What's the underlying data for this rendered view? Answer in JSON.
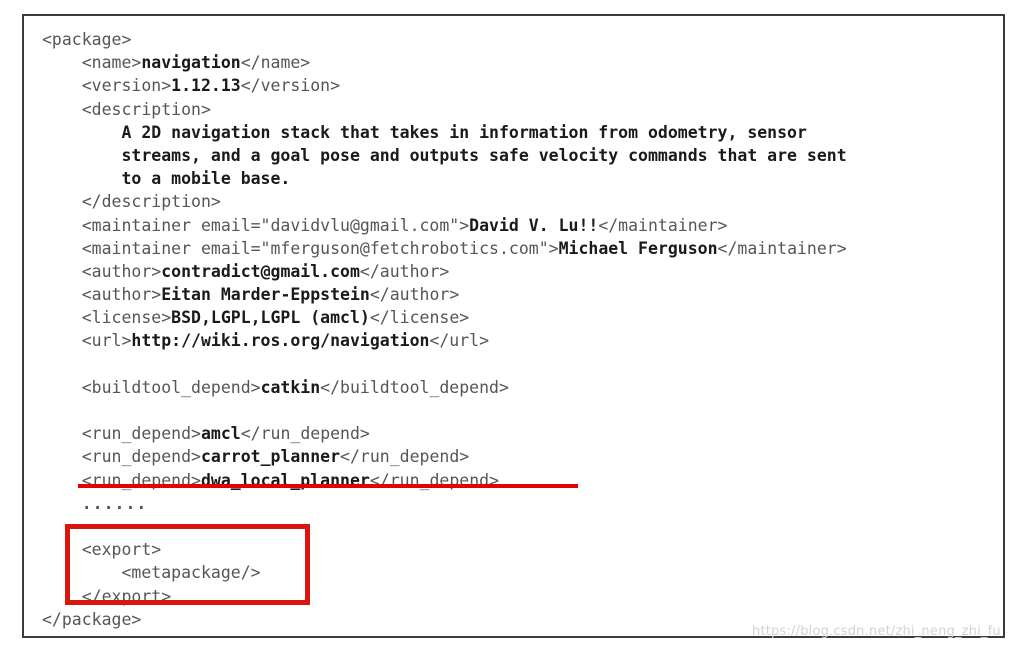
{
  "document": {
    "kind": "xml-code-listing",
    "filename_implied": "package.xml",
    "frame_border_color": "#3c3c3c",
    "background_color": "#ffffff",
    "tag_color": "#55555a",
    "value_color": "#1a1a1a"
  },
  "code": {
    "lines": [
      {
        "indent": 0,
        "segments": [
          {
            "type": "tag",
            "text": "<package>"
          }
        ]
      },
      {
        "indent": 4,
        "segments": [
          {
            "type": "tag",
            "text": "<name>"
          },
          {
            "type": "val",
            "text": "navigation"
          },
          {
            "type": "tag",
            "text": "</name>"
          }
        ]
      },
      {
        "indent": 4,
        "segments": [
          {
            "type": "tag",
            "text": "<version>"
          },
          {
            "type": "val",
            "text": "1.12.13"
          },
          {
            "type": "tag",
            "text": "</version>"
          }
        ]
      },
      {
        "indent": 4,
        "segments": [
          {
            "type": "tag",
            "text": "<description>"
          }
        ]
      },
      {
        "indent": 8,
        "segments": [
          {
            "type": "val",
            "text": "A 2D navigation stack that takes in information from odometry, sensor"
          }
        ]
      },
      {
        "indent": 8,
        "segments": [
          {
            "type": "val",
            "text": "streams, and a goal pose and outputs safe velocity commands that are sent"
          }
        ]
      },
      {
        "indent": 8,
        "segments": [
          {
            "type": "val",
            "text": "to a mobile base."
          }
        ]
      },
      {
        "indent": 4,
        "segments": [
          {
            "type": "tag",
            "text": "</description>"
          }
        ]
      },
      {
        "indent": 4,
        "segments": [
          {
            "type": "tag",
            "text": "<maintainer email=\"davidvlu@gmail.com\">"
          },
          {
            "type": "val",
            "text": "David V. Lu!!"
          },
          {
            "type": "tag",
            "text": "</maintainer>"
          }
        ]
      },
      {
        "indent": 4,
        "segments": [
          {
            "type": "tag",
            "text": "<maintainer email=\"mferguson@fetchrobotics.com\">"
          },
          {
            "type": "val",
            "text": "Michael Ferguson"
          },
          {
            "type": "tag",
            "text": "</maintainer>"
          }
        ]
      },
      {
        "indent": 4,
        "segments": [
          {
            "type": "tag",
            "text": "<author>"
          },
          {
            "type": "val",
            "text": "contradict@gmail.com"
          },
          {
            "type": "tag",
            "text": "</author>"
          }
        ]
      },
      {
        "indent": 4,
        "segments": [
          {
            "type": "tag",
            "text": "<author>"
          },
          {
            "type": "val",
            "text": "Eitan Marder-Eppstein"
          },
          {
            "type": "tag",
            "text": "</author>"
          }
        ]
      },
      {
        "indent": 4,
        "segments": [
          {
            "type": "tag",
            "text": "<license>"
          },
          {
            "type": "val",
            "text": "BSD,LGPL,LGPL (amcl)"
          },
          {
            "type": "tag",
            "text": "</license>"
          }
        ]
      },
      {
        "indent": 4,
        "segments": [
          {
            "type": "tag",
            "text": "<url>"
          },
          {
            "type": "val",
            "text": "http://wiki.ros.org/navigation"
          },
          {
            "type": "tag",
            "text": "</url>"
          }
        ]
      },
      {
        "indent": 0,
        "segments": []
      },
      {
        "indent": 4,
        "segments": [
          {
            "type": "tag",
            "text": "<buildtool_depend>"
          },
          {
            "type": "val",
            "text": "catkin"
          },
          {
            "type": "tag",
            "text": "</buildtool_depend>"
          }
        ]
      },
      {
        "indent": 0,
        "segments": []
      },
      {
        "indent": 4,
        "segments": [
          {
            "type": "tag",
            "text": "<run_depend>"
          },
          {
            "type": "val",
            "text": "amcl"
          },
          {
            "type": "tag",
            "text": "</run_depend>"
          }
        ]
      },
      {
        "indent": 4,
        "segments": [
          {
            "type": "tag",
            "text": "<run_depend>"
          },
          {
            "type": "val",
            "text": "carrot_planner"
          },
          {
            "type": "tag",
            "text": "</run_depend>"
          }
        ]
      },
      {
        "indent": 4,
        "segments": [
          {
            "type": "tag",
            "text": "<run_depend>"
          },
          {
            "type": "val",
            "text": "dwa_local_planner"
          },
          {
            "type": "tag",
            "text": "</run_depend>"
          }
        ]
      },
      {
        "indent": 4,
        "segments": [
          {
            "type": "dots",
            "text": "......"
          }
        ]
      },
      {
        "indent": 0,
        "segments": []
      },
      {
        "indent": 4,
        "segments": [
          {
            "type": "tag",
            "text": "<export>"
          }
        ]
      },
      {
        "indent": 8,
        "segments": [
          {
            "type": "tag",
            "text": "<metapackage/>"
          }
        ]
      },
      {
        "indent": 4,
        "segments": [
          {
            "type": "tag",
            "text": "</export>"
          }
        ]
      },
      {
        "indent": 0,
        "segments": [
          {
            "type": "tag",
            "text": "</package>"
          }
        ]
      }
    ]
  },
  "annotations": {
    "underline": {
      "label": "red-underline-dwa-local-planner",
      "target_line_text": "<run_depend>dwa_local_planner</run_depend>",
      "color": "#e60000"
    },
    "box": {
      "label": "red-box-export-block",
      "target_lines": [
        "<export>",
        "<metapackage/>",
        "</export>"
      ],
      "color": "#d9150f"
    }
  },
  "watermark": {
    "text": "https://blog.csdn.net/zhi_neng_zhi_fu",
    "color": "#d2d2d6"
  }
}
